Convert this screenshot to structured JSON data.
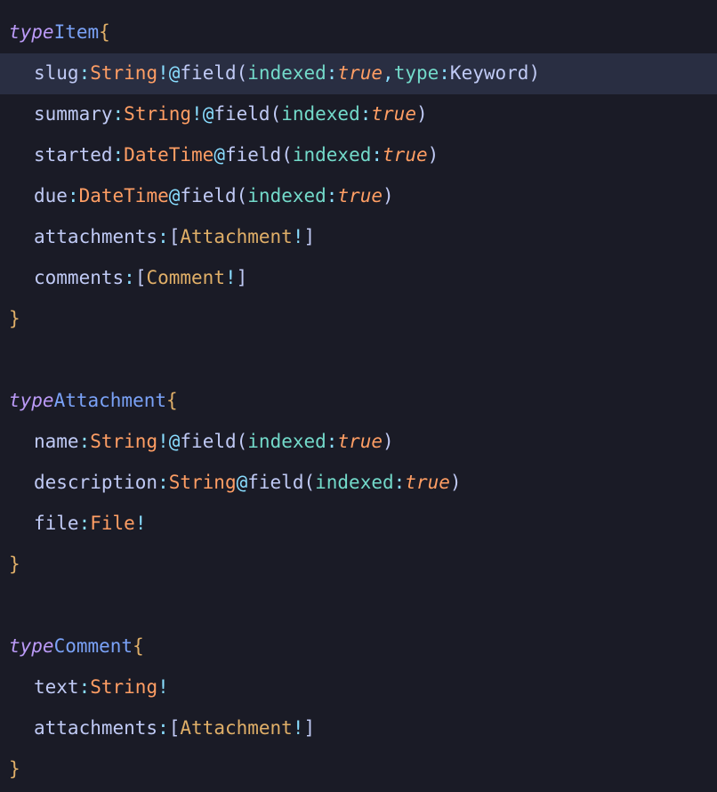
{
  "keywords": {
    "type": "type"
  },
  "punct": {
    "open": "{",
    "close": "}",
    "colon": ":",
    "bang": "!",
    "at": "@",
    "lparen": "(",
    "rparen": ")",
    "lbracket": "[",
    "rbracket": "]",
    "comma": ","
  },
  "types": {
    "item": {
      "name": "Item",
      "fields": {
        "slug": {
          "name": "slug",
          "type": "String",
          "nonNull": true,
          "directive": "field",
          "args": [
            {
              "k": "indexed",
              "v": "true"
            },
            {
              "k": "type",
              "v": "Keyword"
            }
          ]
        },
        "summary": {
          "name": "summary",
          "type": "String",
          "nonNull": true,
          "directive": "field",
          "args": [
            {
              "k": "indexed",
              "v": "true"
            }
          ]
        },
        "started": {
          "name": "started",
          "type": "DateTime",
          "nonNull": false,
          "directive": "field",
          "args": [
            {
              "k": "indexed",
              "v": "true"
            }
          ]
        },
        "due": {
          "name": "due",
          "type": "DateTime",
          "nonNull": false,
          "directive": "field",
          "args": [
            {
              "k": "indexed",
              "v": "true"
            }
          ]
        },
        "attachments": {
          "name": "attachments",
          "listOf": "Attachment"
        },
        "comments": {
          "name": "comments",
          "listOf": "Comment"
        }
      }
    },
    "attachment": {
      "name": "Attachment",
      "fields": {
        "name": {
          "name": "name",
          "type": "String",
          "nonNull": true,
          "directive": "field",
          "args": [
            {
              "k": "indexed",
              "v": "true"
            }
          ]
        },
        "description": {
          "name": "description",
          "type": "String",
          "nonNull": false,
          "directive": "field",
          "args": [
            {
              "k": "indexed",
              "v": "true"
            }
          ]
        },
        "file": {
          "name": "file",
          "type": "File",
          "nonNull": true
        }
      }
    },
    "comment": {
      "name": "Comment",
      "fields": {
        "text": {
          "name": "text",
          "type": "String",
          "nonNull": true
        },
        "attachments": {
          "name": "attachments",
          "listOf": "Attachment"
        }
      }
    }
  },
  "argValues": {
    "true": "true",
    "Keyword": "Keyword"
  }
}
